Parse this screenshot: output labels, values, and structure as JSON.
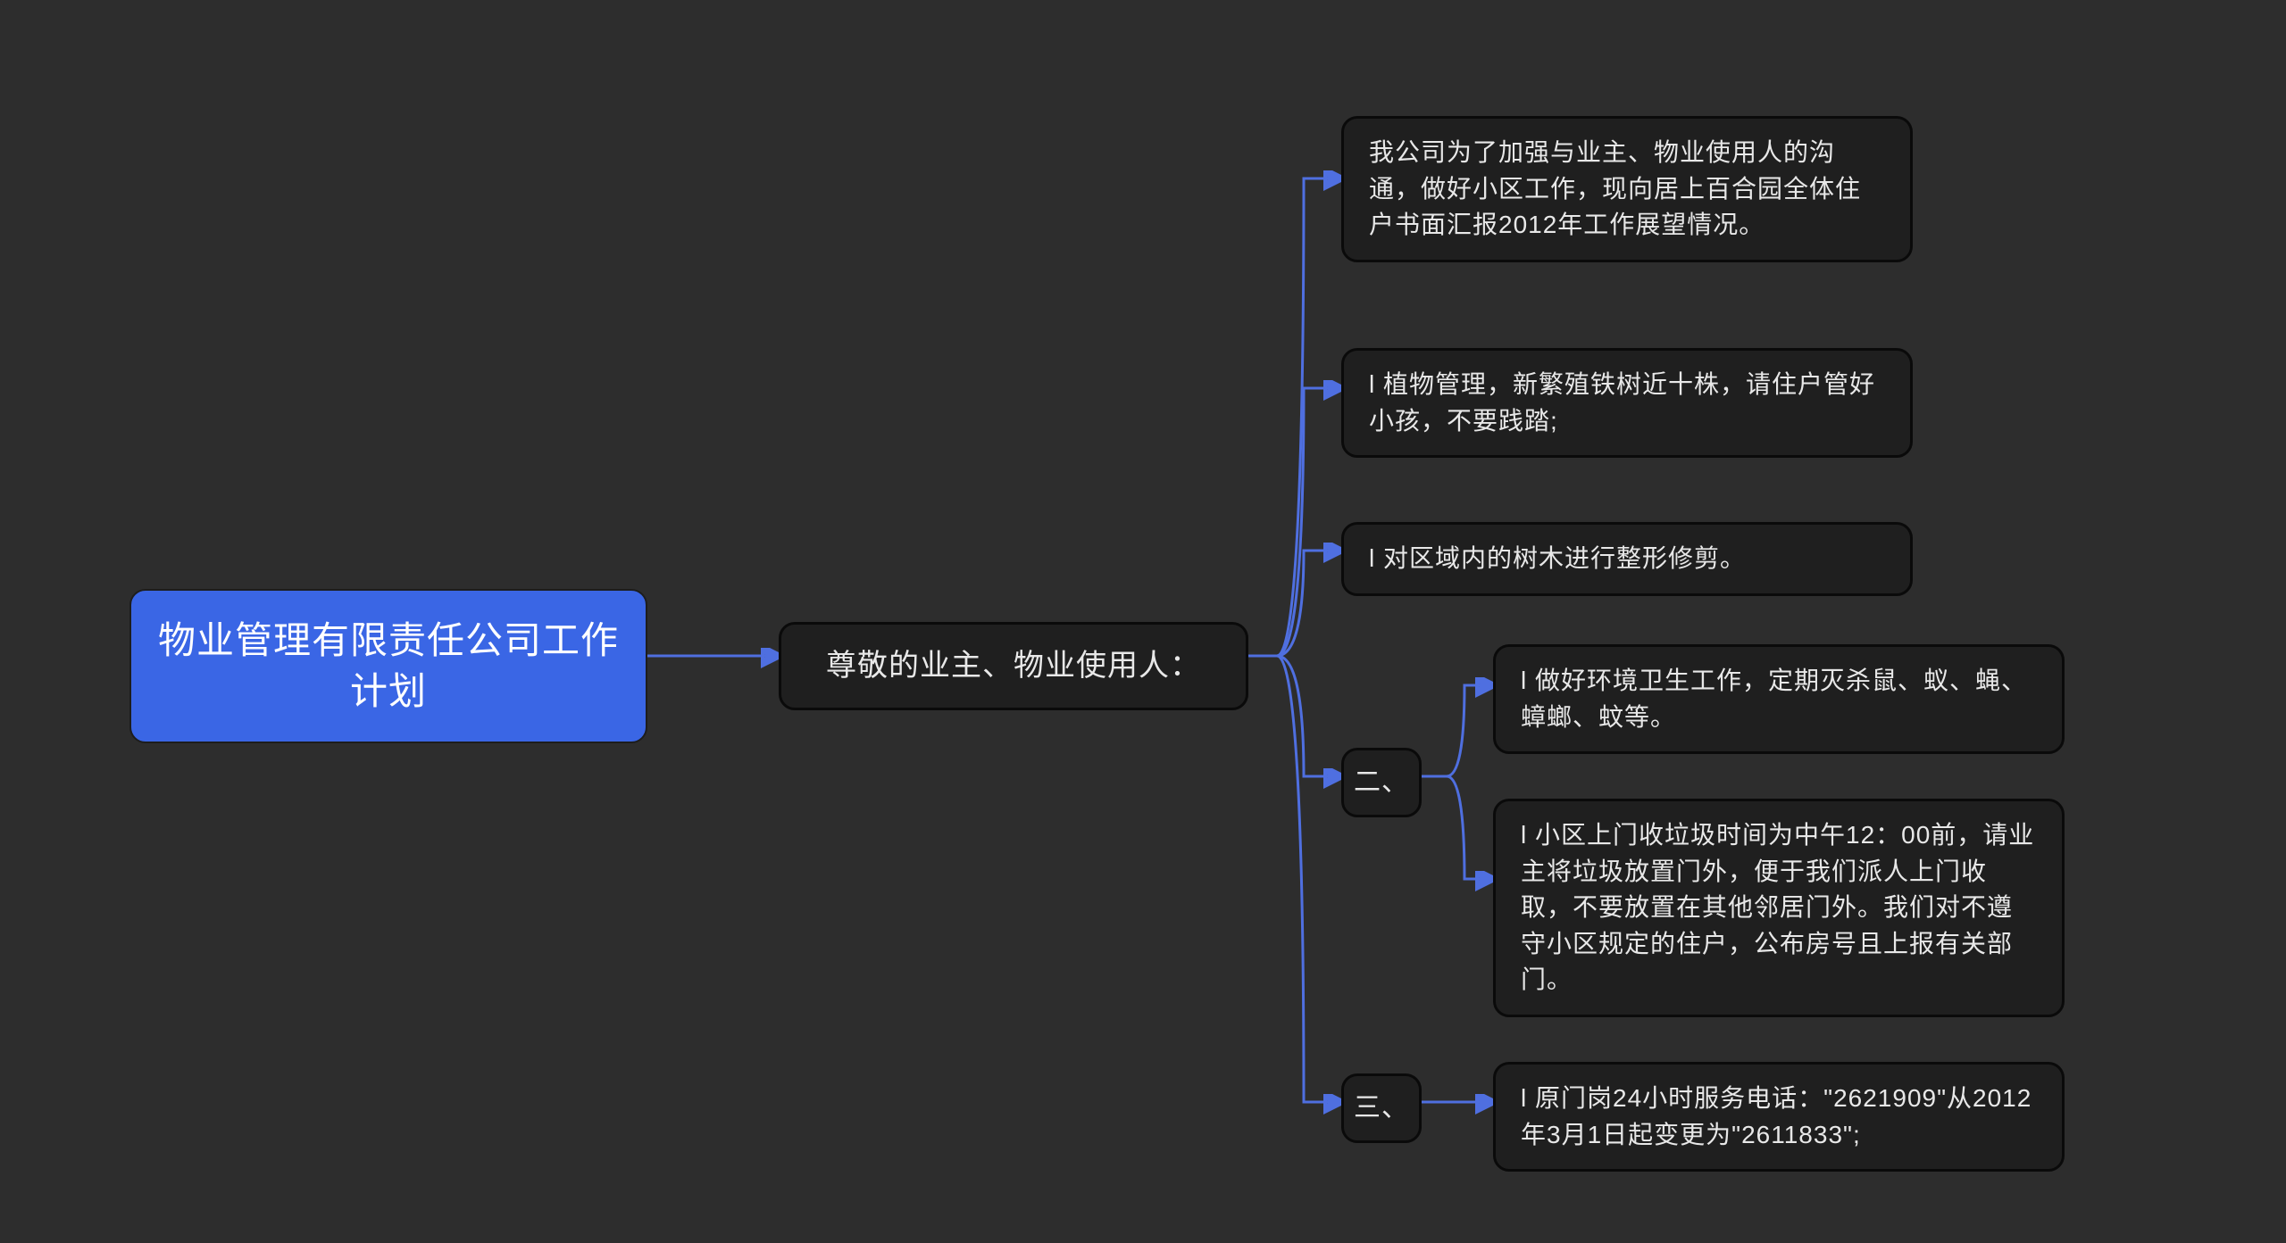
{
  "root": {
    "title": "物业管理有限责任公司工作计划"
  },
  "level1": {
    "text": "尊敬的业主、物业使用人："
  },
  "leaves_direct": [
    "我公司为了加强与业主、物业使用人的沟通，做好小区工作，现向居上百合园全体住户书面汇报2012年工作展望情况。",
    "l 植物管理，新繁殖铁树近十株，请住户管好小孩，不要践踏;",
    "l 对区域内的树木进行整形修剪。"
  ],
  "group2": {
    "label": "二、",
    "children": [
      "l 做好环境卫生工作，定期灭杀鼠、蚁、蝇、蟑螂、蚊等。",
      "l 小区上门收垃圾时间为中午12：00前，请业主将垃圾放置门外，便于我们派人上门收取，不要放置在其他邻居门外。我们对不遵守小区规定的住户，公布房号且上报有关部门。"
    ]
  },
  "group3": {
    "label": "三、",
    "children": [
      "l 原门岗24小时服务电话：\"2621909\"从2012年3月1日起变更为\"2611833\";"
    ]
  }
}
